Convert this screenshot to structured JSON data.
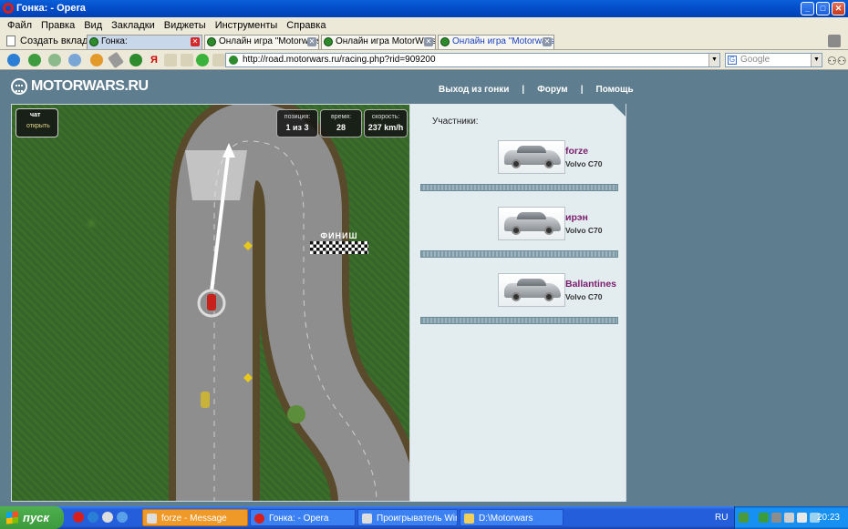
{
  "window": {
    "title": "Гонка: - Opera"
  },
  "menu": [
    "Файл",
    "Правка",
    "Вид",
    "Закладки",
    "Виджеты",
    "Инструменты",
    "Справка"
  ],
  "tabs": {
    "new_tab_label": "Создать вкладку",
    "items": [
      {
        "label": "Гонка:",
        "active": true
      },
      {
        "label": "Онлайн игра \"Motorwars\"",
        "active": false
      },
      {
        "label": "Онлайн игра MotorWars...",
        "active": false
      },
      {
        "label": "Онлайн игра \"Motorwars\"",
        "active": false
      }
    ]
  },
  "address_bar": {
    "url": "http://road.motorwars.ru/racing.php?rid=909200"
  },
  "search": {
    "engine": "G",
    "placeholder": "Google"
  },
  "site": {
    "logo": "MOTORWARS.RU",
    "nav": {
      "exit_race": "Выход из гонки",
      "sep": "|",
      "forum": "Форум",
      "help": "Помощь"
    }
  },
  "game": {
    "chat_title": "чат",
    "chat_open": "открыть",
    "hud": {
      "position_label": "позиция:",
      "position_value": "1 из 3",
      "time_label": "время:",
      "time_value": "28",
      "speed_label": "скорость:",
      "speed_value": "237 km/h"
    },
    "finish_label": "ФИНИШ"
  },
  "players": {
    "title": "Участники:",
    "list": [
      {
        "name": "forze",
        "car": "Volvo C70"
      },
      {
        "name": "ирэн",
        "car": "Volvo C70"
      },
      {
        "name": "Ballantines",
        "car": "Volvo C70"
      }
    ]
  },
  "taskbar": {
    "start": "пуск",
    "tasks": [
      {
        "label": "forze - Message",
        "active": true
      },
      {
        "label": "Гонка: - Opera",
        "active": false
      },
      {
        "label": "Проигрыватель Win...",
        "active": false
      },
      {
        "label": "D:\\Motorwars",
        "active": false
      }
    ],
    "lang": "RU",
    "clock": "20:23"
  }
}
